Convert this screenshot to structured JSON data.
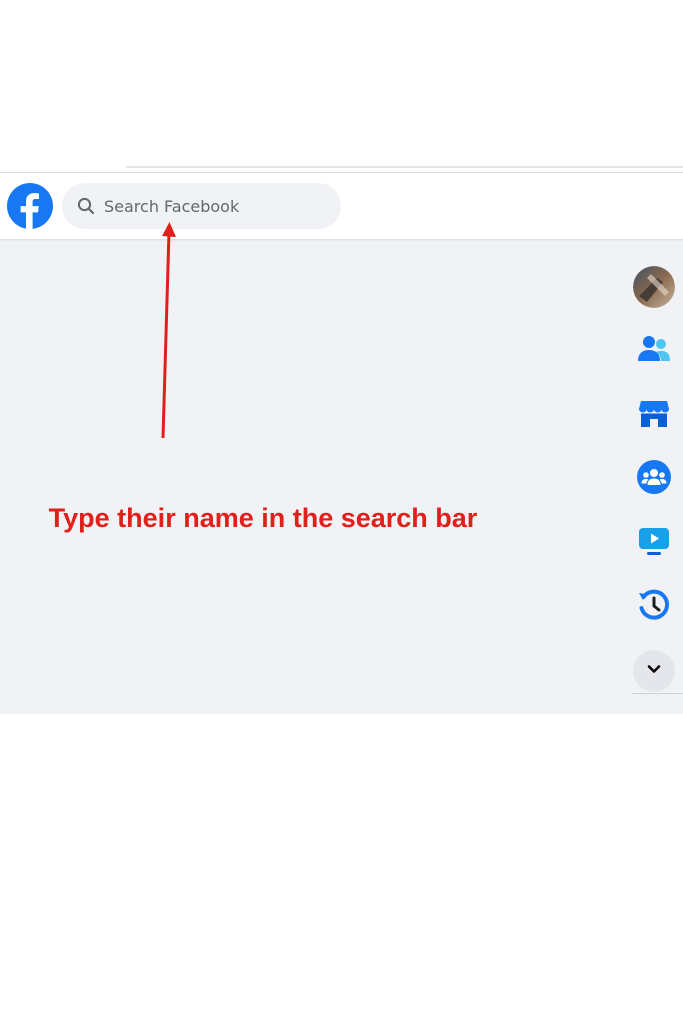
{
  "search": {
    "placeholder": "Search Facebook"
  },
  "icons": {
    "brand_logo": "facebook-logo",
    "search": "search-icon",
    "friends": "friends-icon",
    "marketplace": "marketplace-icon",
    "groups": "groups-icon",
    "watch": "watch-icon",
    "memories": "memories-icon",
    "see_more": "chevron-down-icon"
  },
  "colors": {
    "brand_blue": "#1877f2",
    "annotation_red": "#e0201b",
    "page_bg": "#f0f2f5"
  },
  "annotation": {
    "text": "Type their name in the search bar"
  }
}
